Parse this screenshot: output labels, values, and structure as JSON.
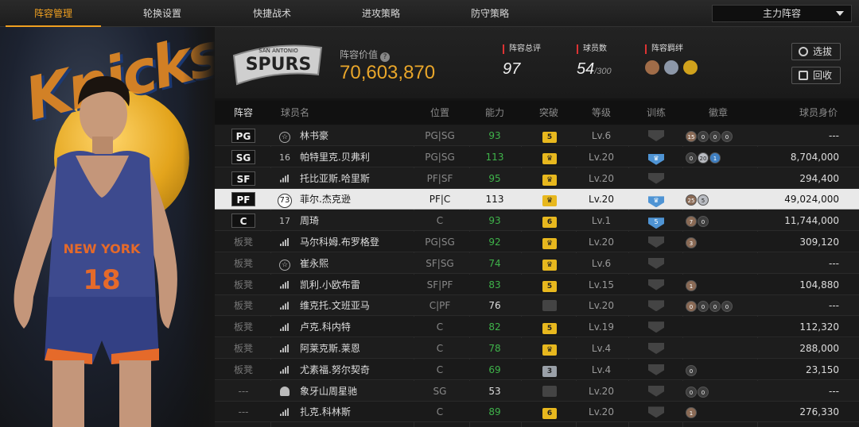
{
  "nav": {
    "tabs": [
      "阵容管理",
      "轮换设置",
      "快捷战术",
      "进攻策略",
      "防守策略"
    ],
    "active_index": 0,
    "lineup_select": "主力阵容"
  },
  "team": {
    "logo_text": "SPURS",
    "logo_sub": "SAN ANTONIO",
    "value_label": "阵容价值",
    "value": "70,603,870",
    "overall_label": "阵容总评",
    "overall": "97",
    "count_label": "球员数",
    "count": "54",
    "count_max": "/300",
    "bond_label": "阵容羁绊"
  },
  "buttons": {
    "draft": "选拔",
    "recycle": "回收"
  },
  "table": {
    "headers": [
      "阵容",
      "球员名",
      "位置",
      "能力",
      "突破",
      "等级",
      "训练",
      "徽章",
      "球员身价"
    ],
    "rows": [
      {
        "slot": "PG",
        "starter": true,
        "icon": "star",
        "name": "林书豪",
        "pos": "PG|SG",
        "ability": "93",
        "ab_green": true,
        "bt": "5",
        "bt_type": "gold",
        "lvl": "Lv.6",
        "train": "",
        "train_type": "dark",
        "badges": [
          [
            "15",
            "bronze"
          ],
          [
            "0",
            ""
          ],
          [
            "0",
            ""
          ],
          [
            "0",
            ""
          ]
        ],
        "worth": "---"
      },
      {
        "slot": "SG",
        "starter": true,
        "icon": "num",
        "num": "16",
        "name": "帕特里克.贝弗利",
        "pos": "PG|SG",
        "ability": "113",
        "ab_green": true,
        "bt": "♛",
        "bt_type": "gold",
        "lvl": "Lv.20",
        "train": "♛",
        "train_type": "blue",
        "badges": [
          [
            "0",
            ""
          ],
          [
            "20",
            "silver"
          ],
          [
            "1",
            "blue"
          ]
        ],
        "worth": "8,704,000"
      },
      {
        "slot": "SF",
        "starter": true,
        "icon": "bars",
        "name": "托比亚斯.哈里斯",
        "pos": "PF|SF",
        "ability": "95",
        "ab_green": true,
        "bt": "♛",
        "bt_type": "gold",
        "lvl": "Lv.20",
        "train": "",
        "train_type": "dark",
        "badges": [],
        "worth": "294,400"
      },
      {
        "slot": "PF",
        "starter": true,
        "icon": "circle",
        "num": "73",
        "name": "菲尔.杰克逊",
        "pos": "PF|C",
        "ability": "113",
        "ab_green": false,
        "bt": "♛",
        "bt_type": "gold",
        "lvl": "Lv.20",
        "train": "♛",
        "train_type": "blue",
        "badges": [
          [
            "25",
            "bronze"
          ],
          [
            "5",
            "silver"
          ]
        ],
        "worth": "49,024,000",
        "selected": true
      },
      {
        "slot": "C",
        "starter": true,
        "icon": "num",
        "num": "17",
        "name": "周琦",
        "pos": "C",
        "ability": "93",
        "ab_green": true,
        "bt": "6",
        "bt_type": "gold",
        "lvl": "Lv.1",
        "train": "5",
        "train_type": "blue",
        "badges": [
          [
            "7",
            "bronze"
          ],
          [
            "0",
            ""
          ]
        ],
        "worth": "11,744,000"
      },
      {
        "slot": "板凳",
        "starter": false,
        "icon": "bars",
        "name": "马尔科姆.布罗格登",
        "pos": "PG|SG",
        "ability": "92",
        "ab_green": true,
        "bt": "♛",
        "bt_type": "gold",
        "lvl": "Lv.20",
        "train": "",
        "train_type": "dark",
        "badges": [
          [
            "3",
            "bronze"
          ]
        ],
        "worth": "309,120"
      },
      {
        "slot": "板凳",
        "starter": false,
        "icon": "star",
        "name": "崔永熙",
        "pos": "SF|SG",
        "ability": "74",
        "ab_green": true,
        "bt": "♛",
        "bt_type": "gold",
        "lvl": "Lv.6",
        "train": "",
        "train_type": "dark",
        "badges": [],
        "worth": "---"
      },
      {
        "slot": "板凳",
        "starter": false,
        "icon": "bars",
        "name": "凯利.小欧布雷",
        "pos": "SF|PF",
        "ability": "83",
        "ab_green": true,
        "bt": "5",
        "bt_type": "gold",
        "lvl": "Lv.15",
        "train": "",
        "train_type": "dark",
        "badges": [
          [
            "1",
            "bronze"
          ]
        ],
        "worth": "104,880"
      },
      {
        "slot": "板凳",
        "starter": false,
        "icon": "bars",
        "name": "维克托.文班亚马",
        "pos": "C|PF",
        "ability": "76",
        "ab_green": false,
        "bt": "",
        "bt_type": "grey",
        "lvl": "Lv.20",
        "train": "",
        "train_type": "dark",
        "badges": [
          [
            "0",
            "bronze"
          ],
          [
            "0",
            ""
          ],
          [
            "0",
            ""
          ],
          [
            "0",
            ""
          ]
        ],
        "worth": "---"
      },
      {
        "slot": "板凳",
        "starter": false,
        "icon": "bars",
        "name": "卢克.科内特",
        "pos": "C",
        "ability": "82",
        "ab_green": true,
        "bt": "5",
        "bt_type": "gold",
        "lvl": "Lv.19",
        "train": "",
        "train_type": "dark",
        "badges": [],
        "worth": "112,320"
      },
      {
        "slot": "板凳",
        "starter": false,
        "icon": "bars",
        "name": "阿莱克斯.莱恩",
        "pos": "C",
        "ability": "78",
        "ab_green": true,
        "bt": "♛",
        "bt_type": "gold",
        "lvl": "Lv.4",
        "train": "",
        "train_type": "dark",
        "badges": [],
        "worth": "288,000"
      },
      {
        "slot": "板凳",
        "starter": false,
        "icon": "bars",
        "name": "尤素福.努尔契奇",
        "pos": "C",
        "ability": "69",
        "ab_green": true,
        "bt": "3",
        "bt_type": "silver",
        "lvl": "Lv.4",
        "train": "",
        "train_type": "dark",
        "badges": [
          [
            "0",
            ""
          ]
        ],
        "worth": "23,150"
      },
      {
        "slot": "---",
        "starter": false,
        "icon": "person",
        "name": "象牙山周星驰",
        "pos": "SG",
        "ability": "53",
        "ab_green": false,
        "bt": "",
        "bt_type": "grey",
        "lvl": "Lv.20",
        "train": "",
        "train_type": "dark",
        "badges": [
          [
            "0",
            ""
          ],
          [
            "0",
            ""
          ]
        ],
        "worth": "---"
      },
      {
        "slot": "---",
        "starter": false,
        "icon": "bars",
        "name": "扎克.科林斯",
        "pos": "C",
        "ability": "89",
        "ab_green": true,
        "bt": "6",
        "bt_type": "gold",
        "lvl": "Lv.20",
        "train": "",
        "train_type": "dark",
        "badges": [
          [
            "1",
            "bronze"
          ]
        ],
        "worth": "276,330"
      }
    ]
  },
  "art": {
    "logo_word": "Knicks",
    "jersey_text": "NEW YORK",
    "jersey_number": "18"
  }
}
